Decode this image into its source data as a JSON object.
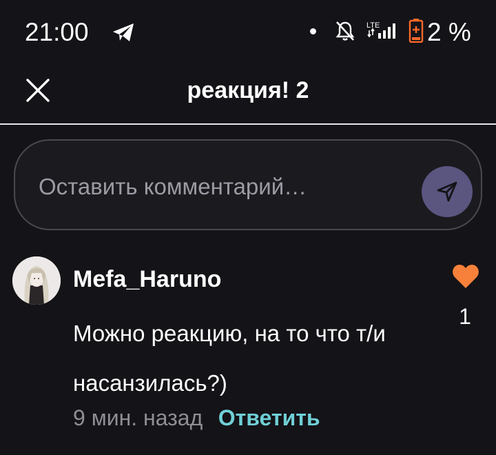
{
  "status_bar": {
    "time": "21:00",
    "network_label": "LTE",
    "battery_text": "2 %"
  },
  "header": {
    "title": "реакция! 2"
  },
  "comment_input": {
    "placeholder": "Оставить комментарий…",
    "value": ""
  },
  "comment": {
    "author": "Mefa_Haruno",
    "text": "Можно реакцию, на то что т/и насанзилась?)",
    "time": "9 мин. назад",
    "reply_label": "Ответить",
    "like_count": "1"
  },
  "colors": {
    "background": "#141317",
    "send_button": "#5a5680",
    "like_heart": "#f7813a",
    "reply_link": "#6fd0d6",
    "battery_warning": "#ff6a2a"
  },
  "icons": {
    "status": [
      "telegram-icon",
      "dot-icon",
      "bell-off-icon",
      "signal-icon",
      "battery-icon"
    ],
    "header": [
      "close-icon"
    ],
    "input": [
      "send-icon"
    ],
    "comment": [
      "heart-icon"
    ]
  }
}
